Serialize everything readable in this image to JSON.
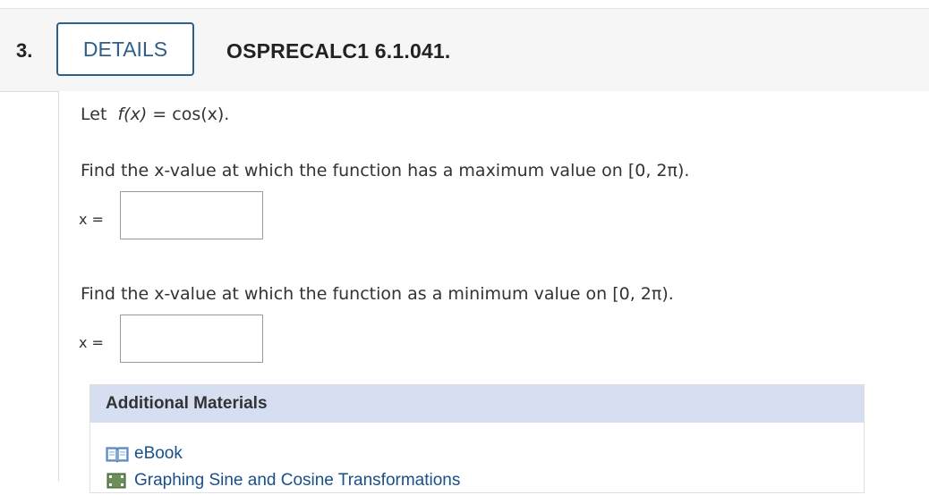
{
  "question": {
    "number": "3.",
    "details_label": "DETAILS",
    "id": "OSPRECALC1 6.1.041."
  },
  "problem": {
    "let_text": "Let",
    "function": "f(x)",
    "equals": "=",
    "definition": "cos(x).",
    "part1": {
      "prompt": "Find the x-value at which the function has a maximum value on [0, 2π).",
      "var_label": "x =",
      "value": ""
    },
    "part2": {
      "prompt": "Find the x-value at which the function as a minimum value on [0, 2π).",
      "var_label": "x =",
      "value": ""
    }
  },
  "materials": {
    "title": "Additional Materials",
    "items": [
      {
        "label": "eBook",
        "icon": "book-icon"
      },
      {
        "label": "Graphing Sine and Cosine Transformations",
        "icon": "video-icon"
      }
    ]
  }
}
